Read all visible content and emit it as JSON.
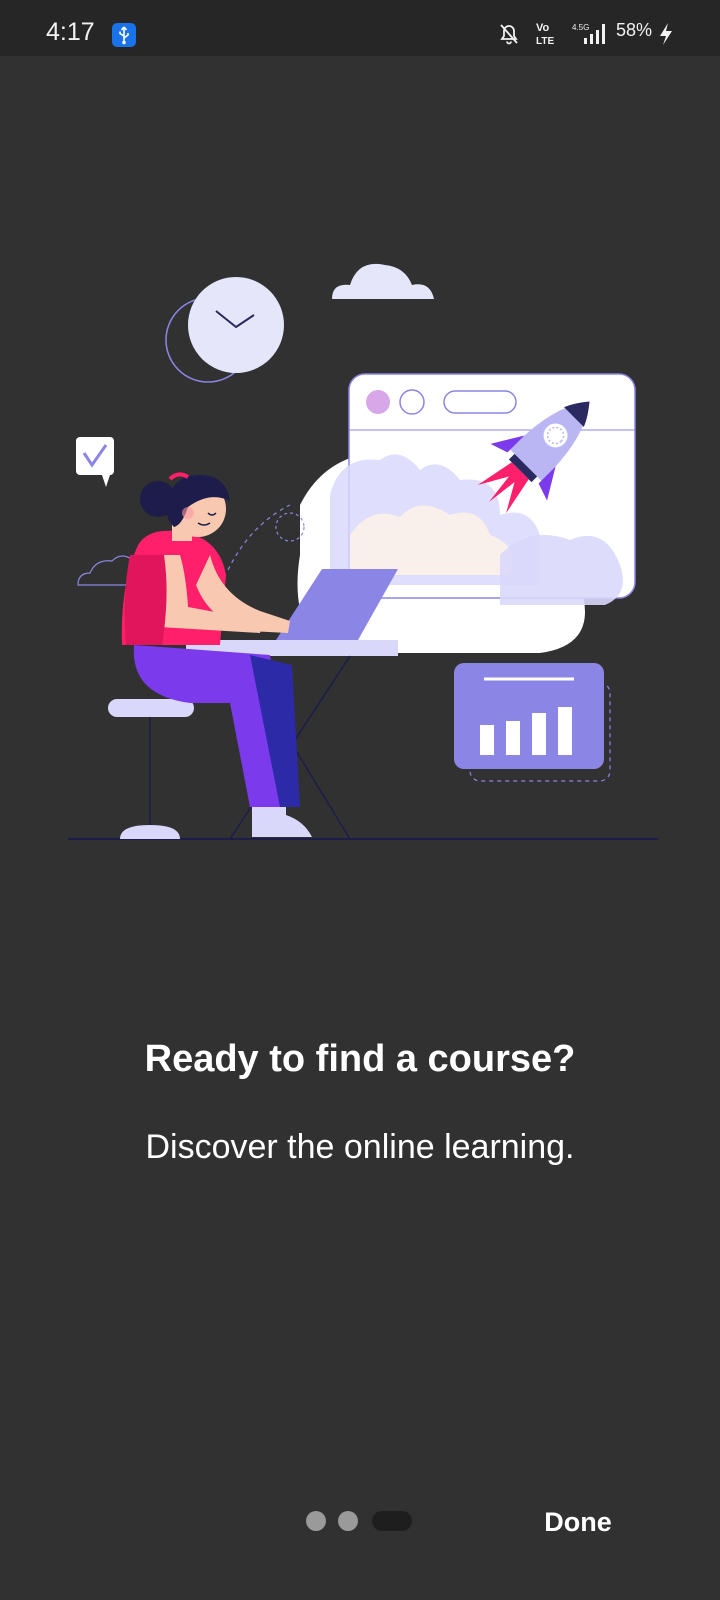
{
  "status_bar": {
    "time": "4:17",
    "battery": "58%",
    "network": "4.5G",
    "volte": "Vo LTE"
  },
  "onboarding": {
    "title": "Ready to find a course?",
    "subtitle": "Discover the online learning.",
    "page_count": 3,
    "current_page": 3
  },
  "actions": {
    "done_label": "Done"
  },
  "colors": {
    "background": "#313131",
    "accent_purple": "#7c3aed",
    "accent_pink": "#ff1f6b",
    "light_lavender": "#d9d8fb"
  },
  "icons": [
    "usb-icon",
    "mute-bell-icon",
    "volte-icon",
    "signal-icon",
    "charging-icon"
  ]
}
